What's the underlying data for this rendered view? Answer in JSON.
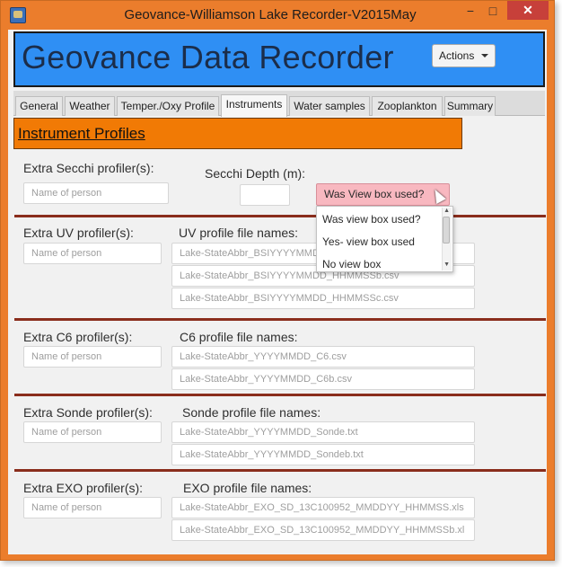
{
  "window": {
    "title": "Geovance-Williamson Lake Recorder-V2015May",
    "close_glyph": "✕",
    "minimize_glyph": "−",
    "maximize_glyph": "□"
  },
  "header": {
    "title": "Geovance Data Recorder",
    "actions_label": "Actions"
  },
  "tabs": [
    {
      "label": "General"
    },
    {
      "label": "Weather"
    },
    {
      "label": "Temper./Oxy Profile"
    },
    {
      "label": "Instruments"
    },
    {
      "label": "Water samples"
    },
    {
      "label": "Zooplankton"
    },
    {
      "label": "Summary"
    }
  ],
  "active_tab": "Instruments",
  "section": {
    "title": "Instrument Profiles"
  },
  "secchi": {
    "profiler_label": "Extra Secchi profiler(s):",
    "profiler_placeholder": "Name of person",
    "depth_label": "Secchi Depth (m):",
    "depth_value": "",
    "viewbox_selected": "Was View box used?",
    "viewbox_options": [
      "Was view box used?",
      "Yes- view box used",
      "No view box"
    ]
  },
  "uv": {
    "profiler_label": "Extra UV profiler(s):",
    "profiler_placeholder": "Name of person",
    "files_label": "UV profile file names:",
    "file_placeholders": [
      "Lake-StateAbbr_BSIYYYYMMDD_HHMMSS.csv",
      "Lake-StateAbbr_BSIYYYYMMDD_HHMMSSb.csv",
      "Lake-StateAbbr_BSIYYYYMMDD_HHMMSSc.csv"
    ]
  },
  "c6": {
    "profiler_label": "Extra C6 profiler(s):",
    "profiler_placeholder": "Name of person",
    "files_label": "C6 profile file names:",
    "file_placeholders": [
      "Lake-StateAbbr_YYYYMMDD_C6.csv",
      "Lake-StateAbbr_YYYYMMDD_C6b.csv"
    ]
  },
  "sonde": {
    "profiler_label": "Extra Sonde profiler(s):",
    "profiler_placeholder": "Name of person",
    "files_label": "Sonde profile file names:",
    "file_placeholders": [
      "Lake-StateAbbr_YYYYMMDD_Sonde.txt",
      "Lake-StateAbbr_YYYYMMDD_Sondeb.txt"
    ]
  },
  "exo": {
    "profiler_label": "Extra EXO profiler(s):",
    "profiler_placeholder": "Name of person",
    "files_label": "EXO profile file names:",
    "file_placeholders": [
      "Lake-StateAbbr_EXO_SD_13C100952_MMDDYY_HHMMSS.xls",
      "Lake-StateAbbr_EXO_SD_13C100952_MMDDYY_HHMMSSb.xl"
    ]
  },
  "colors": {
    "window_frame": "#eb7d2c",
    "banner": "#2f8ff4",
    "section_header": "#f17a05",
    "divider": "#8a2d1c",
    "combo_highlight": "#f8b8c0"
  }
}
